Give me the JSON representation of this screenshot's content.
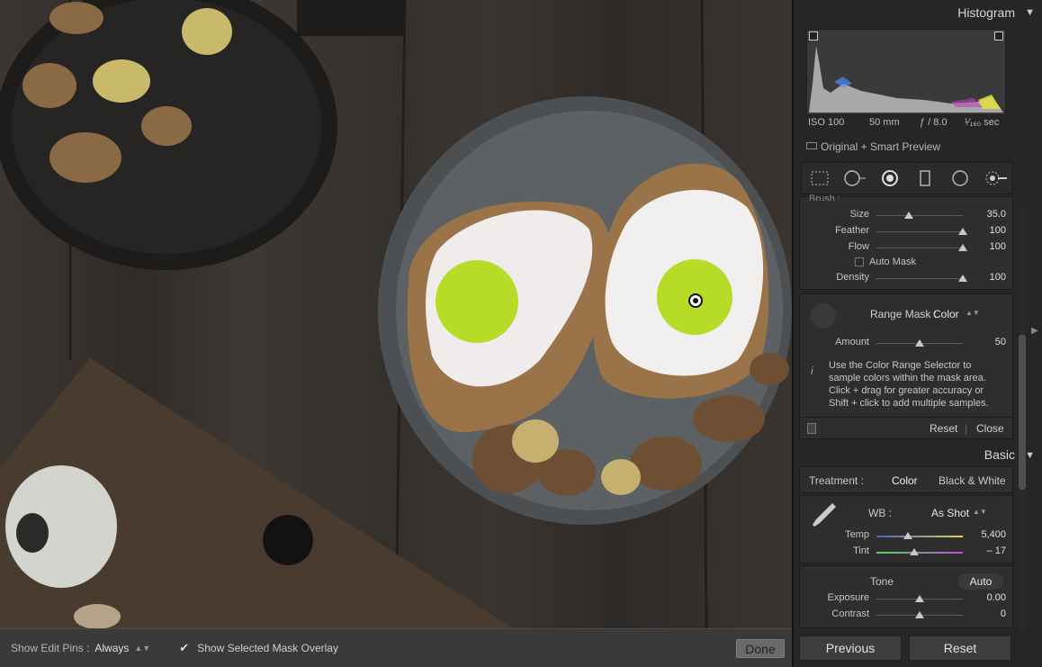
{
  "toolbar": {
    "edit_pins_label": "Show Edit Pins :",
    "edit_pins_value": "Always",
    "mask_overlay_label": "Show Selected Mask Overlay",
    "mask_overlay_checked": true,
    "done_label": "Done"
  },
  "histogram": {
    "title": "Histogram",
    "iso": "ISO 100",
    "focal": "50 mm",
    "aperture": "ƒ / 8.0",
    "shutter": "¹⁄₁₆₀ sec",
    "preview_label": "Original + Smart Preview"
  },
  "tool_strip": {
    "tools": [
      "crop-overlay-icon",
      "spot-removal-icon",
      "red-eye-icon",
      "graduated-filter-icon",
      "radial-filter-icon",
      "adjustment-brush-icon"
    ]
  },
  "brush": {
    "partial_header": "Brush :",
    "size_label": "Size",
    "size_value": "35.0",
    "size_level": 0.38,
    "feather_label": "Feather",
    "feather_value": "100",
    "feather_level": 1.0,
    "flow_label": "Flow",
    "flow_value": "100",
    "flow_level": 1.0,
    "auto_mask_label": "Auto Mask",
    "auto_mask_checked": false,
    "density_label": "Density",
    "density_value": "100",
    "density_level": 1.0
  },
  "range_mask": {
    "label": "Range Mask :",
    "value": "Color",
    "amount_label": "Amount",
    "amount_value": "50",
    "amount_level": 0.5,
    "info_line1": "Use the Color Range Selector to",
    "info_line2": "sample colors within the mask area.",
    "info_line3": "Click + drag for greater accuracy or",
    "info_line4": "Shift + click to add multiple samples.",
    "reset_label": "Reset",
    "close_label": "Close"
  },
  "basic": {
    "title": "Basic",
    "treatment_label": "Treatment :",
    "color_label": "Color",
    "bw_label": "Black & White",
    "wb_label": "WB :",
    "wb_value": "As Shot",
    "temp_label": "Temp",
    "temp_value": "5,400",
    "temp_level": 0.36,
    "tint_label": "Tint",
    "tint_value": "– 17",
    "tint_level": 0.44,
    "tone_label": "Tone",
    "auto_label": "Auto",
    "exposure_label": "Exposure",
    "exposure_value": "0.00",
    "exposure_level": 0.5,
    "contrast_label": "Contrast",
    "contrast_value": "0",
    "contrast_level": 0.5
  },
  "footer": {
    "previous_label": "Previous",
    "reset_label": "Reset"
  },
  "colors": {
    "panel_bg": "#262626",
    "section_bg": "#2e2e2e",
    "mask_overlay": "#c8e83a",
    "temp_gradient": [
      "#4a5bd8",
      "#e0d84a"
    ],
    "tint_gradient": [
      "#4ad85a",
      "#c84ad8"
    ]
  }
}
